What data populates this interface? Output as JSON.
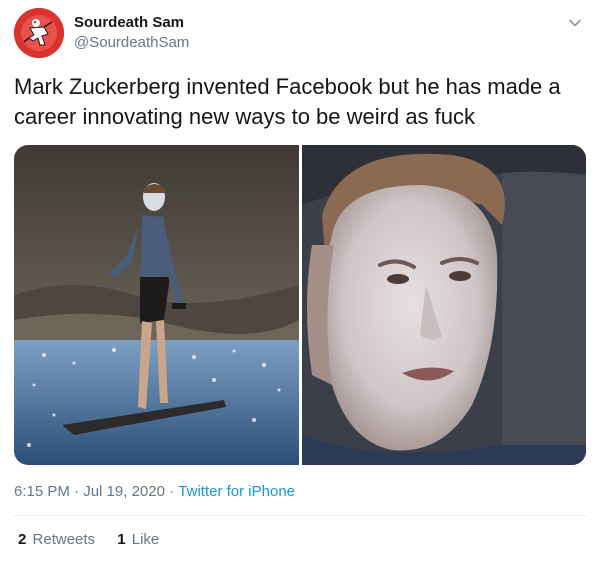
{
  "author": {
    "display_name": "Sourdeath Sam",
    "handle": "@SourdeathSam",
    "avatar_icon": "avatar-illustration",
    "avatar_color": "#d8332c"
  },
  "menu_icon": "chevron-down-icon",
  "tweet": {
    "text": "Mark Zuckerberg invented Facebook but he has made a\ncareer innovating new ways to be weird as fuck"
  },
  "media": {
    "photos": [
      "surfer-photo",
      "face-closeup-photo"
    ]
  },
  "meta": {
    "time": "6:15 PM",
    "separator": "·",
    "date": "Jul 19, 2020",
    "source": "Twitter for iPhone"
  },
  "stats": {
    "retweets_count": "2",
    "retweets_label": "Retweets",
    "likes_count": "1",
    "likes_label": "Like"
  },
  "colors": {
    "text": "#14171a",
    "secondary": "#657786",
    "link": "#1b95e0",
    "divider": "#e6ecf0"
  }
}
